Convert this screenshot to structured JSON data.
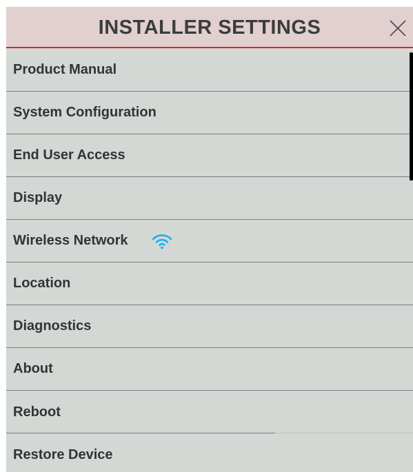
{
  "header": {
    "title": "INSTALLER SETTINGS",
    "close_icon": "close-icon"
  },
  "menu": {
    "items": [
      {
        "label": "Product Manual"
      },
      {
        "label": "System Configuration"
      },
      {
        "label": "End User Access"
      },
      {
        "label": "Display"
      },
      {
        "label": "Wireless Network",
        "icon": "wifi-icon"
      },
      {
        "label": "Location"
      },
      {
        "label": "Diagnostics"
      },
      {
        "label": "About"
      },
      {
        "label": "Reboot"
      },
      {
        "label": "Restore Device"
      }
    ]
  },
  "colors": {
    "header_bg": "#e2cfcf",
    "header_border": "#e02424",
    "panel_bg": "#d4d8d5",
    "wifi": "#1ab0f0"
  }
}
